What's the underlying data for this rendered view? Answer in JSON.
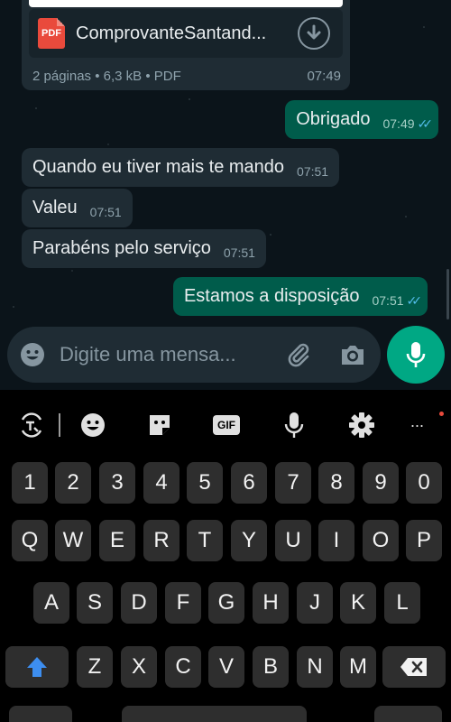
{
  "document": {
    "icon_label": "PDF",
    "file_name": "ComprovanteSantand...",
    "meta": "2 páginas • 6,3 kB • PDF",
    "time": "07:49"
  },
  "messages": [
    {
      "direction": "out",
      "text": "Obrigado",
      "time": "07:49",
      "ticks": "✓✓"
    },
    {
      "direction": "in",
      "text": "Quando eu tiver mais te mando",
      "time": "07:51"
    },
    {
      "direction": "in",
      "text": "Valeu",
      "time": "07:51"
    },
    {
      "direction": "in",
      "text": "Parabéns pelo serviço",
      "time": "07:51"
    },
    {
      "direction": "out",
      "text": "Estamos a disposição",
      "time": "07:51",
      "ticks": "✓✓"
    }
  ],
  "input": {
    "placeholder": "Digite uma mensa..."
  },
  "keyboard": {
    "toolbar": [
      "translate-icon",
      "emoji-icon",
      "sticker-icon",
      "GIF",
      "mic-icon",
      "settings-icon",
      "more-icon"
    ],
    "gif_label": "GIF",
    "more_label": "···",
    "number_row": [
      "1",
      "2",
      "3",
      "4",
      "5",
      "6",
      "7",
      "8",
      "9",
      "0"
    ],
    "row1": [
      "Q",
      "W",
      "E",
      "R",
      "T",
      "Y",
      "U",
      "I",
      "O",
      "P"
    ],
    "row2": [
      "A",
      "S",
      "D",
      "F",
      "G",
      "H",
      "J",
      "K",
      "L"
    ],
    "row3": [
      "Z",
      "X",
      "C",
      "V",
      "B",
      "N",
      "M"
    ]
  },
  "colors": {
    "outgoing_bubble": "#005c4b",
    "incoming_bubble": "#1f2c34",
    "accent": "#00a884",
    "read_ticks": "#53bdeb",
    "shift_arrow": "#3d8ef0"
  }
}
